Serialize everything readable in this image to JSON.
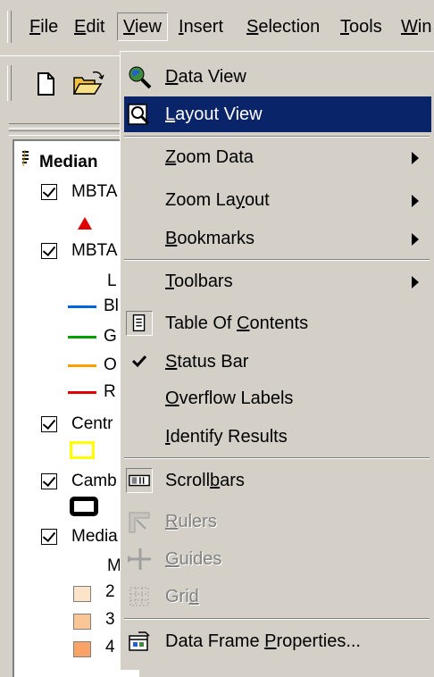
{
  "menubar": {
    "items": [
      {
        "label": "File",
        "u": "F"
      },
      {
        "label": "Edit",
        "u": "E"
      },
      {
        "label": "View",
        "u": "V"
      },
      {
        "label": "Insert",
        "u": "I"
      },
      {
        "label": "Selection",
        "u": "S"
      },
      {
        "label": "Tools",
        "u": "T"
      },
      {
        "label": "Win",
        "u": "W"
      }
    ]
  },
  "toc": {
    "title": "Median",
    "layers": [
      {
        "name": "MBTA"
      },
      {
        "name": "MBTA"
      },
      {
        "name": "Centr"
      },
      {
        "name": "Camb"
      },
      {
        "name": "Media"
      }
    ],
    "legend_labels": [
      "L",
      "Bl",
      "G",
      "O",
      "R",
      "M",
      "2",
      "3",
      "4"
    ],
    "colors": {
      "blue": "#0064dc",
      "green": "#00a000",
      "orange": "#ffa000",
      "red": "#e00000",
      "yellow": "#ffff00",
      "swatch1": "#fde4c8",
      "swatch2": "#fbc695",
      "swatch3": "#f9a366"
    }
  },
  "view_menu": {
    "items": [
      {
        "pre": "",
        "u": "D",
        "post": "ata View",
        "icon": "data-view-icon"
      },
      {
        "pre": "",
        "u": "L",
        "post": "ayout View",
        "icon": "layout-view-icon",
        "selected": true
      },
      {
        "pre": "",
        "u": "Z",
        "post": "oom Data",
        "submenu": true
      },
      {
        "pre": "Zoom La",
        "u": "y",
        "post": "out",
        "submenu": true
      },
      {
        "pre": "",
        "u": "B",
        "post": "ookmarks",
        "submenu": true
      },
      {
        "pre": "",
        "u": "T",
        "post": "oolbars",
        "submenu": true
      },
      {
        "pre": "Table Of ",
        "u": "C",
        "post": "ontents",
        "icon": "table-of-contents-icon"
      },
      {
        "pre": "",
        "u": "S",
        "post": "tatus Bar",
        "icon": "checkmark-icon"
      },
      {
        "pre": "",
        "u": "O",
        "post": "verflow Labels"
      },
      {
        "pre": "",
        "u": "I",
        "post": "dentify Results"
      },
      {
        "pre": "Scroll",
        "u": "b",
        "post": "ars",
        "icon": "scrollbars-icon"
      },
      {
        "pre": "",
        "u": "R",
        "post": "ulers",
        "icon": "rulers-icon",
        "disabled": true
      },
      {
        "pre": "",
        "u": "G",
        "post": "uides",
        "icon": "guides-icon",
        "disabled": true
      },
      {
        "pre": "Gri",
        "u": "d",
        "post": "",
        "icon": "grid-icon",
        "disabled": true
      },
      {
        "pre": "Data Frame ",
        "u": "P",
        "post": "roperties...",
        "icon": "data-frame-properties-icon"
      }
    ]
  }
}
